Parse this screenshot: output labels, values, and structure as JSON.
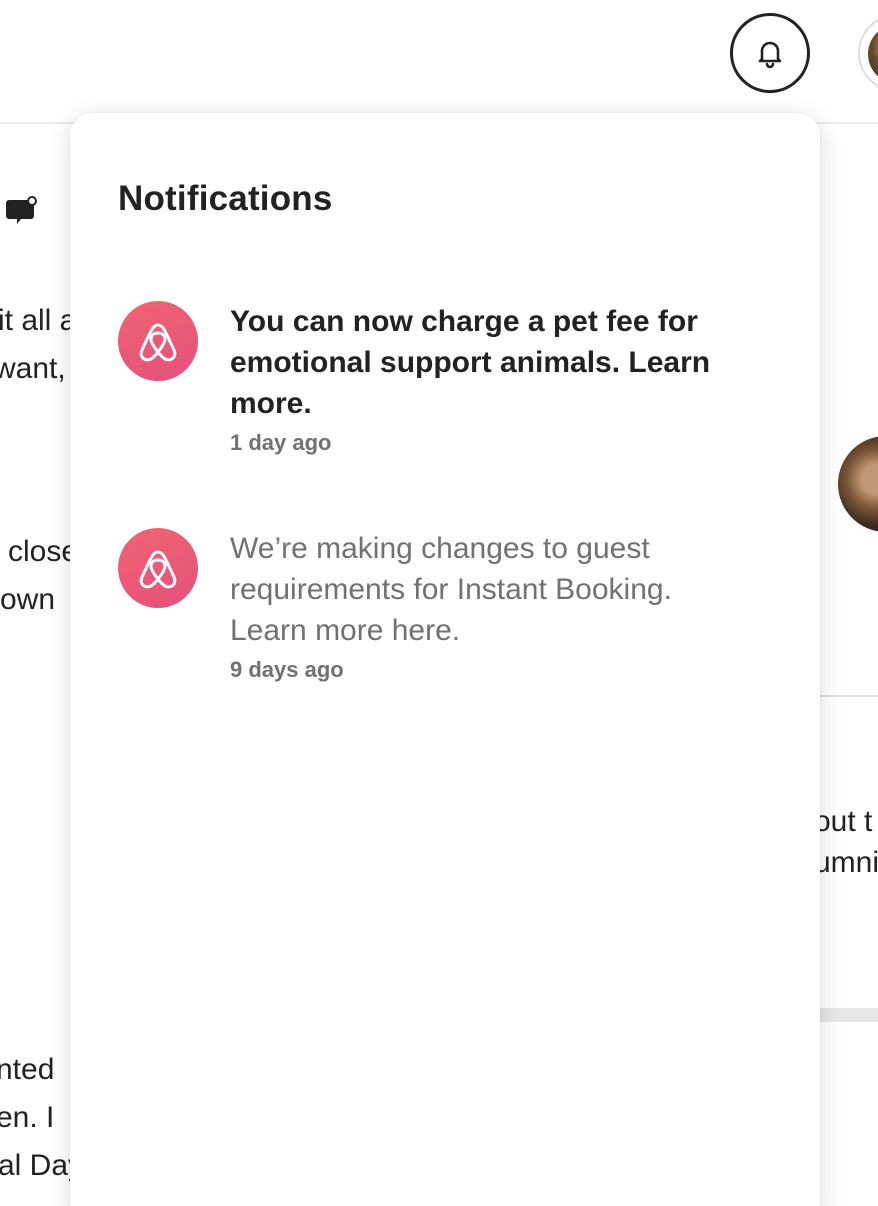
{
  "background": {
    "fragments": [
      {
        "id": "frag1",
        "text": "it all a"
      },
      {
        "id": "frag2",
        "text": "want,"
      },
      {
        "id": "frag3",
        "text": "close"
      },
      {
        "id": "frag4",
        "text": "own"
      },
      {
        "id": "frag5",
        "text": "out t"
      },
      {
        "id": "frag6",
        "text": "umni"
      },
      {
        "id": "frag7",
        "text": "nted"
      },
      {
        "id": "frag8",
        "text": "en. I"
      },
      {
        "id": "frag9",
        "text": "al Day"
      }
    ]
  },
  "header": {
    "bell_icon": "bell-icon",
    "avatar_icon": "profile-avatar"
  },
  "notifications": {
    "title": "Notifications",
    "items": [
      {
        "message": "You can now charge a pet fee for emotional support animals. Learn more.",
        "time": "1 day ago",
        "unread": true,
        "icon": "airbnb-logo-icon"
      },
      {
        "message": "We’re making changes to guest requirements for Instant Booking. Learn more here.",
        "time": "9 days ago",
        "unread": false,
        "icon": "airbnb-logo-icon"
      }
    ]
  },
  "colors": {
    "brand": "#e6507d",
    "text_primary": "#222222",
    "text_secondary": "#717171"
  }
}
